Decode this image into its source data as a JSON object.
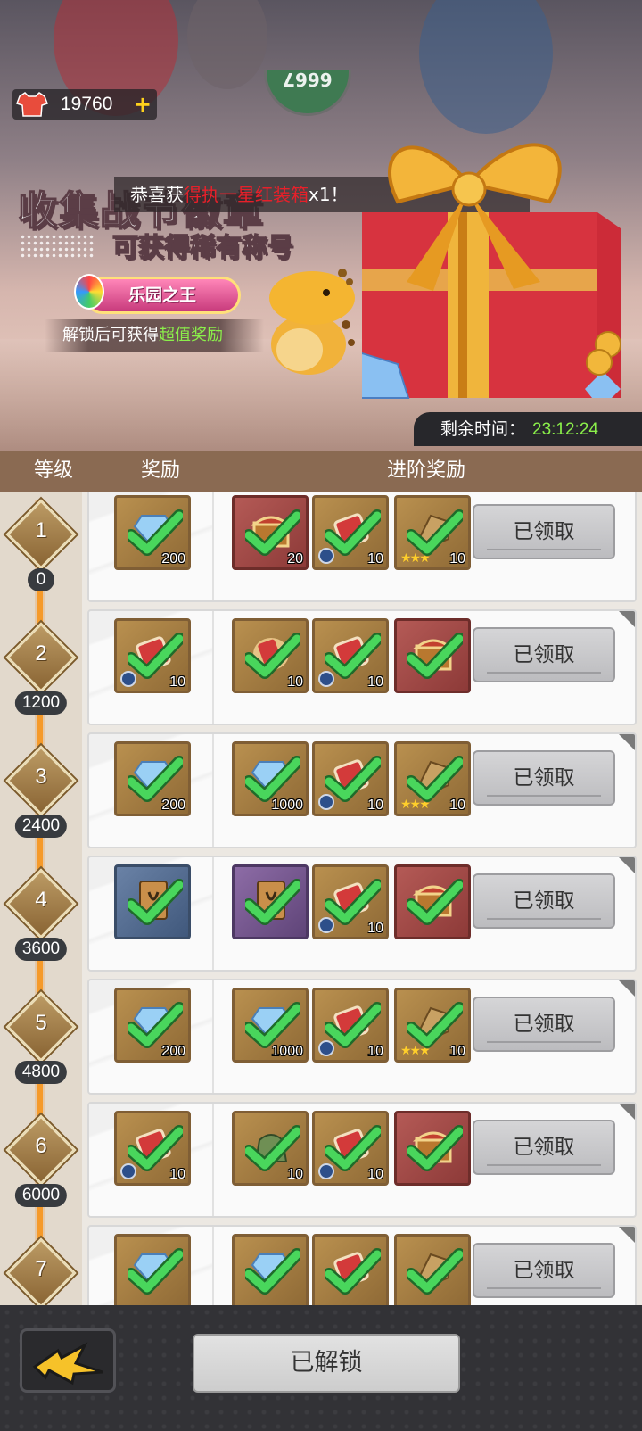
{
  "currency": {
    "value": "19760",
    "plus": "+",
    "icon": "shirt-icon"
  },
  "banner": {
    "knob_text": "6667",
    "notification": {
      "prefix": "恭喜获",
      "item": "得执一星红装箱",
      "suffix": "x1！"
    },
    "title": "收集战节徽章",
    "subtitle": "可获得稀有称号",
    "badge": "乐园之王",
    "hint": {
      "text": "解锁后可获得",
      "highlight": "超值奖励"
    },
    "timer": {
      "label": "剩余时间：",
      "value": "23:12:24"
    }
  },
  "header": {
    "level": "等级",
    "reward": "奖励",
    "advanced": "进阶奖励"
  },
  "colors": {
    "accent_green": "#8bf04a",
    "track_orange": "#f59a2a",
    "notify_red": "#e6202a"
  },
  "rows": [
    {
      "level": "1",
      "points": "0",
      "free": {
        "type": "diamond",
        "qty": "200",
        "color": "gold"
      },
      "adv": [
        {
          "type": "chest",
          "qty": "20",
          "color": "red"
        },
        {
          "type": "ticket",
          "qty": "10",
          "color": "gold",
          "clock": true
        },
        {
          "type": "fragment",
          "qty": "10",
          "color": "gold",
          "stars": true
        }
      ],
      "claim": "已领取"
    },
    {
      "level": "2",
      "points": "1200",
      "free": {
        "type": "ticket",
        "qty": "10",
        "color": "gold",
        "clock": true
      },
      "adv": [
        {
          "type": "ticket-red",
          "qty": "10",
          "color": "gold"
        },
        {
          "type": "ticket",
          "qty": "10",
          "color": "gold",
          "clock": true
        },
        {
          "type": "chest",
          "qty": "",
          "color": "red"
        }
      ],
      "claim": "已领取"
    },
    {
      "level": "3",
      "points": "2400",
      "free": {
        "type": "diamond",
        "qty": "200",
        "color": "gold"
      },
      "adv": [
        {
          "type": "diamond",
          "qty": "1000",
          "color": "gold"
        },
        {
          "type": "ticket",
          "qty": "10",
          "color": "gold",
          "clock": true
        },
        {
          "type": "fragment",
          "qty": "10",
          "color": "gold",
          "stars": true
        }
      ],
      "claim": "已领取"
    },
    {
      "level": "4",
      "points": "3600",
      "free": {
        "type": "card",
        "qty": "",
        "color": "blue"
      },
      "adv": [
        {
          "type": "card",
          "qty": "",
          "color": "purple"
        },
        {
          "type": "ticket",
          "qty": "10",
          "color": "gold",
          "clock": true
        },
        {
          "type": "chest",
          "qty": "",
          "color": "red"
        }
      ],
      "claim": "已领取"
    },
    {
      "level": "5",
      "points": "4800",
      "free": {
        "type": "diamond",
        "qty": "200",
        "color": "gold"
      },
      "adv": [
        {
          "type": "diamond",
          "qty": "1000",
          "color": "gold"
        },
        {
          "type": "ticket",
          "qty": "10",
          "color": "gold",
          "clock": true
        },
        {
          "type": "fragment",
          "qty": "10",
          "color": "gold",
          "stars": true
        }
      ],
      "claim": "已领取"
    },
    {
      "level": "6",
      "points": "6000",
      "free": {
        "type": "ticket",
        "qty": "10",
        "color": "gold",
        "clock": true
      },
      "adv": [
        {
          "type": "bag",
          "qty": "10",
          "color": "gold"
        },
        {
          "type": "ticket",
          "qty": "10",
          "color": "gold",
          "clock": true
        },
        {
          "type": "chest",
          "qty": "",
          "color": "red"
        }
      ],
      "claim": "已领取"
    },
    {
      "level": "7",
      "points": "",
      "free": {
        "type": "diamond",
        "qty": "",
        "color": "gold"
      },
      "adv": [
        {
          "type": "diamond",
          "qty": "",
          "color": "gold"
        },
        {
          "type": "ticket",
          "qty": "",
          "color": "gold"
        },
        {
          "type": "fragment",
          "qty": "",
          "color": "gold"
        }
      ],
      "claim": "已领取"
    }
  ],
  "footer": {
    "unlock_button": "已解锁",
    "back_icon": "lightning-arrow-icon"
  }
}
